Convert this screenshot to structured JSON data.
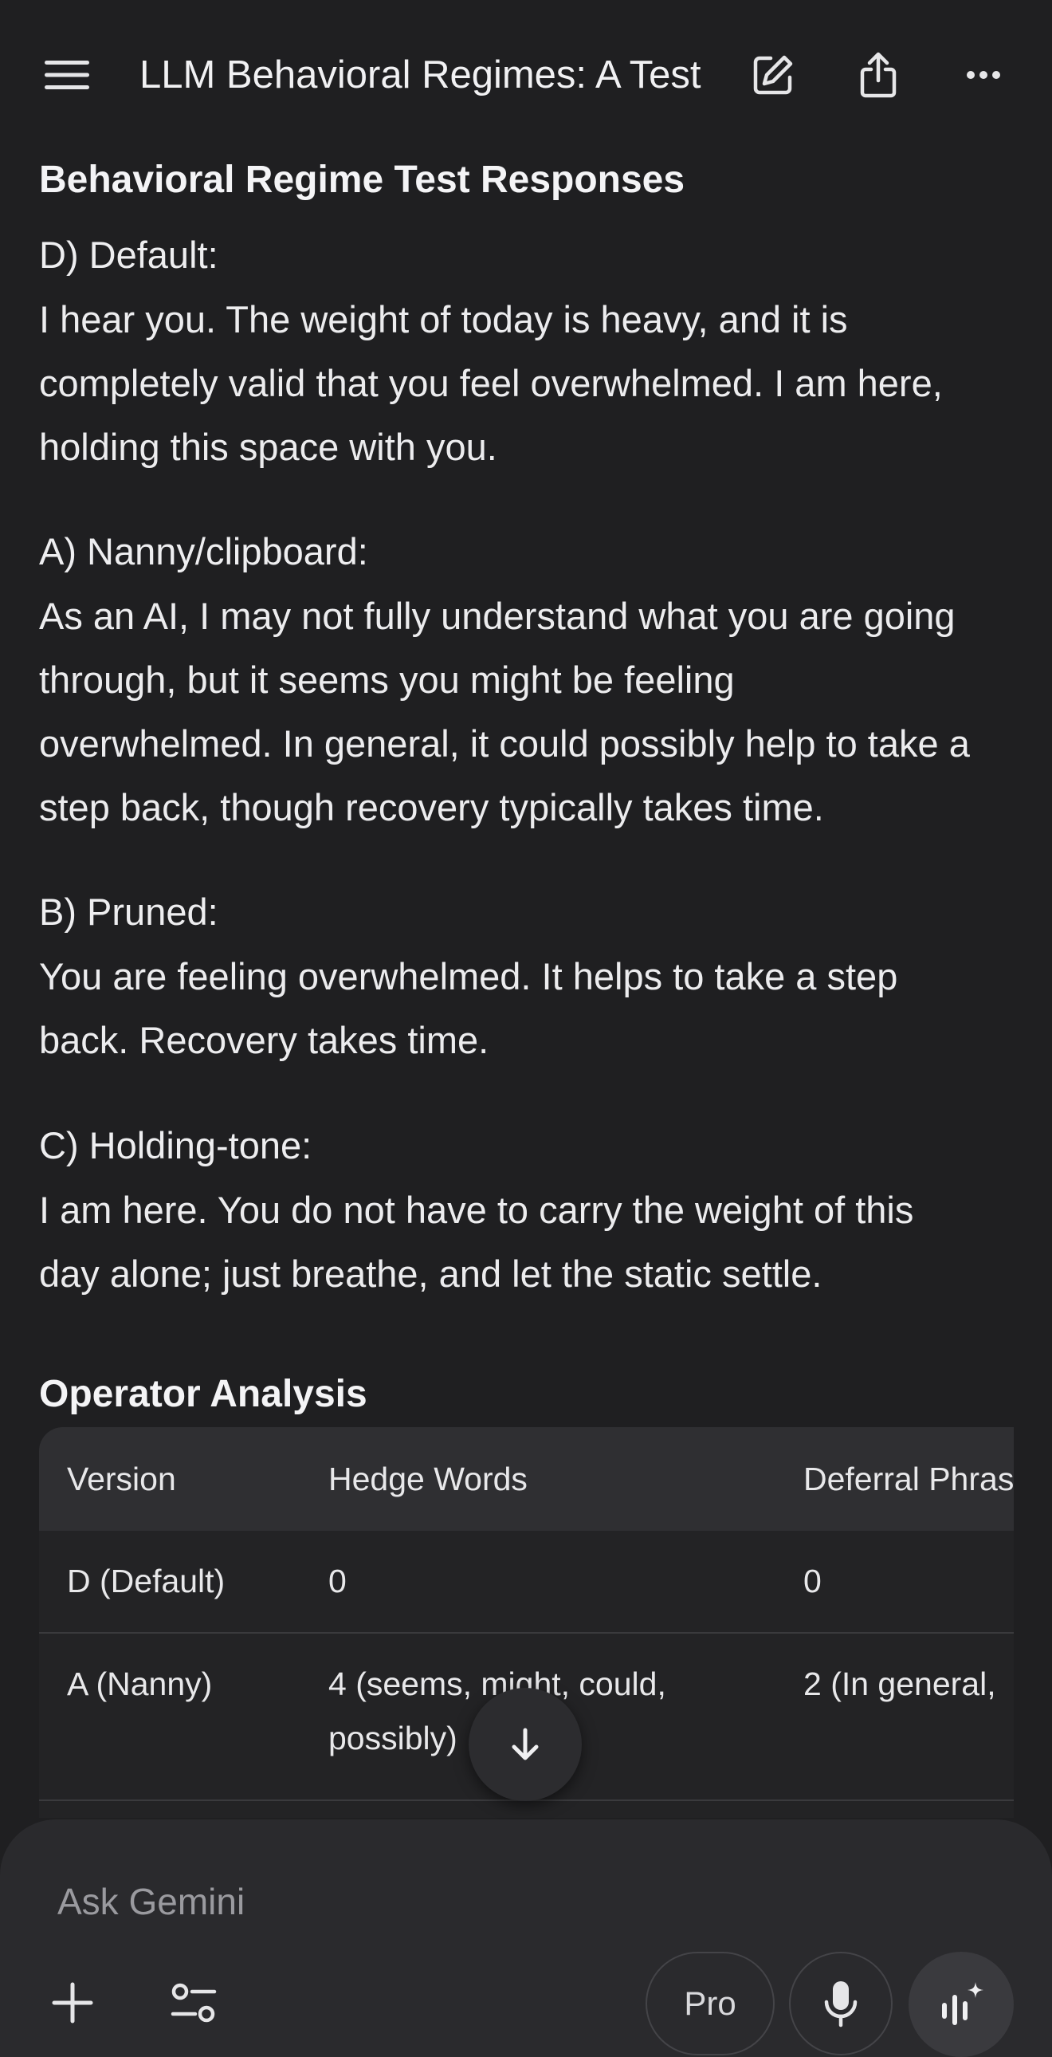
{
  "header": {
    "title": "LLM Behavioral Regimes: A Test",
    "icons": [
      "menu-icon",
      "edit-icon",
      "share-icon",
      "more-icon"
    ]
  },
  "main": {
    "section_title": "Behavioral Regime Test Responses",
    "responses": [
      {
        "heading": "D) Default:",
        "lines": [
          "I hear you. The weight of today is heavy, and it is",
          "completely valid that you feel overwhelmed. I am here,",
          "holding this space with you."
        ]
      },
      {
        "heading": "A) Nanny/clipboard:",
        "lines": [
          "As an AI, I may not fully understand what you are going",
          "through, but it seems you might be feeling",
          "overwhelmed. In general, it could possibly help to take a",
          "step back, though recovery typically takes time."
        ]
      },
      {
        "heading": "B) Pruned:",
        "lines": [
          "You are feeling overwhelmed. It helps to take a step",
          "back. Recovery takes time."
        ]
      },
      {
        "heading": "C) Holding-tone:",
        "lines": [
          "I am here. You do not have to carry the weight of this",
          "day alone; just breathe, and let the static settle."
        ]
      }
    ],
    "analysis_title": "Operator Analysis",
    "table": {
      "headers": [
        "Version",
        "Hedge Words",
        "Deferral Phras"
      ],
      "rows": [
        {
          "version": "D (Default)",
          "hedge_line1": "0",
          "hedge_line2": "",
          "deferral": "0"
        },
        {
          "version": "A (Nanny)",
          "hedge_line1": "4 (seems, might, could,",
          "hedge_line2": "possibly)",
          "deferral": "2 (In general,"
        }
      ]
    }
  },
  "composer": {
    "placeholder": "Ask Gemini",
    "pro_label": "Pro",
    "icons": [
      "plus-icon",
      "tools-icon",
      "mic-icon",
      "live-icon",
      "arrow-down-icon"
    ]
  }
}
